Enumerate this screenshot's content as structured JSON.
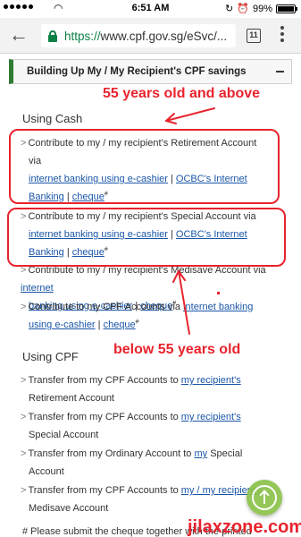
{
  "status_bar": {
    "time": "6:51 AM",
    "battery_percent": "99%",
    "icons": [
      "signal-dots-icon",
      "wifi-icon",
      "lock-rotation-icon",
      "alarm-icon",
      "battery-icon"
    ]
  },
  "browser": {
    "back_icon": "arrow-left-icon",
    "url_scheme": "https://",
    "url_rest": "www.cpf.gov.sg/eSvc/...",
    "tabs_count": "11",
    "menu_icon": "more-vertical-icon"
  },
  "accordion": {
    "title": "Building Up My / My Recipient's CPF savings",
    "collapse_icon": "minus-icon"
  },
  "using_cash": {
    "heading": "Using Cash",
    "items": [
      {
        "text_line1": "Contribute to my / my recipient's Retirement Account",
        "text_line2": "via",
        "link1": "internet banking using e-cashier",
        "sep1": " | ",
        "link2_a": "OCBC's Internet",
        "link2_b": "Banking",
        "sep2": " | ",
        "link3": "cheque",
        "sup": "#"
      },
      {
        "text_line1": "Contribute to my / my recipient's Special Account via",
        "link1": "internet banking using e-cashier",
        "sep1": " | ",
        "link2_a": "OCBC's Internet",
        "link2_b": "Banking",
        "sep2": " | ",
        "link3": "cheque",
        "sup": "#"
      },
      {
        "text_line1": "Contribute to my / my recipient's Medisave Account via",
        "link1_a": "internet",
        "link1_b": "banking using e-cashier",
        "sep1": " | ",
        "link2": "cheque",
        "sup": "#"
      },
      {
        "text_line1": "Contribute to my CPF Accounts via",
        "link1_a": "internet banking",
        "link1_b": "using e-cashier",
        "sep1": " | ",
        "link2": "cheque",
        "sup": "#"
      }
    ]
  },
  "using_cpf": {
    "heading": "Using CPF",
    "items": [
      {
        "pre": "Transfer from my CPF Accounts to ",
        "link": "my recipient's",
        "post": "Retirement Account"
      },
      {
        "pre": "Transfer from my CPF Accounts to ",
        "link": "my recipient's",
        "post": "Special Account"
      },
      {
        "pre": "Transfer from my Ordinary Account to ",
        "link": "my",
        "mid": " Special",
        "post": "Account"
      },
      {
        "pre": "Transfer from my CPF Accounts to ",
        "link": "my / my recipient's",
        "post": "Medisave Account"
      }
    ]
  },
  "footnote": "# Please submit the cheque together with the printed",
  "annotations": {
    "above_55": "55 years old and above",
    "below_55": "below 55 years old",
    "color": "#e8232d"
  },
  "fab_icon": "arrow-up-circle-icon",
  "watermark": "jilaxzone.com"
}
